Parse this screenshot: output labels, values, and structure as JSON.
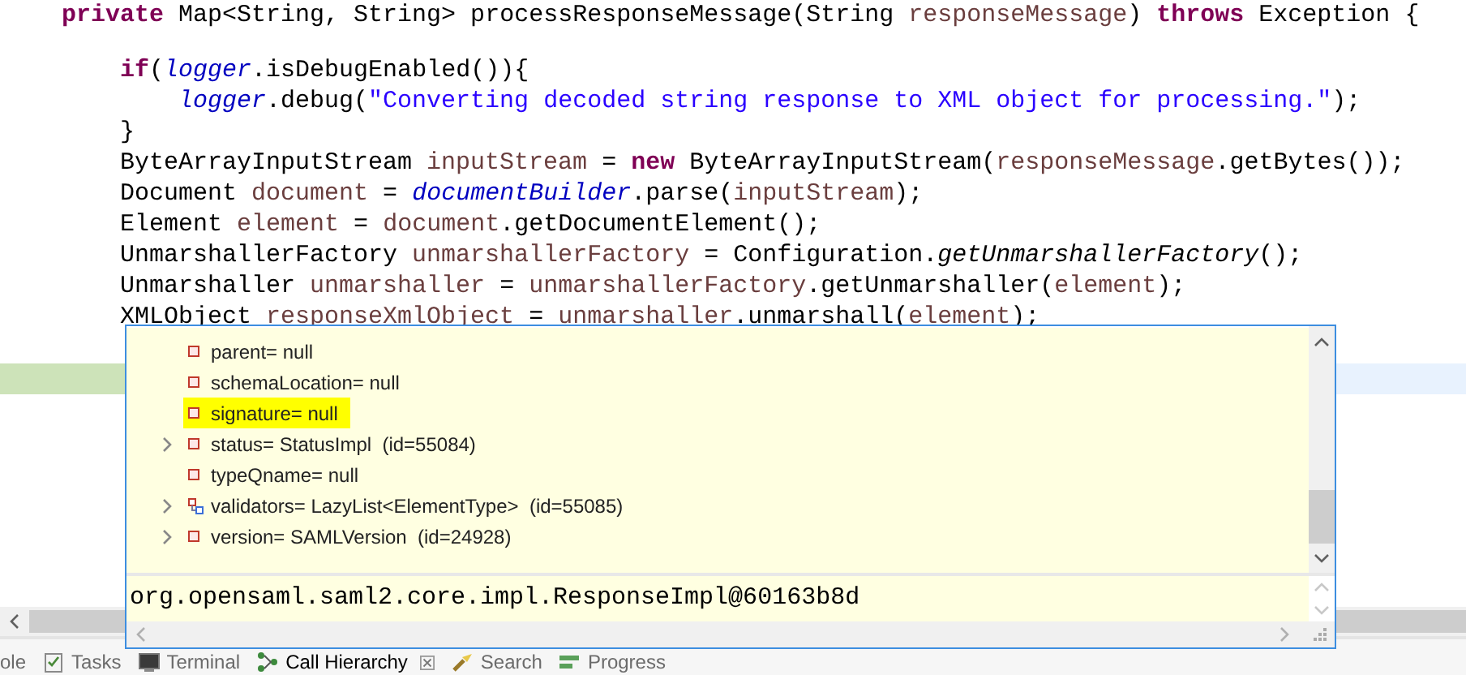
{
  "editor": {
    "lines": [
      {
        "kind": "code",
        "tokens": [
          {
            "kind": "keyword",
            "text": "    private"
          },
          {
            "kind": "plain",
            "text": " Map<String, String> processResponseMessage(String "
          },
          {
            "kind": "variable",
            "text": "responseMessage"
          },
          {
            "kind": "plain",
            "text": ") "
          },
          {
            "kind": "keyword",
            "text": "throws"
          },
          {
            "kind": "plain",
            "text": " Exception {"
          }
        ]
      },
      {
        "kind": "blank"
      },
      {
        "kind": "code",
        "tokens": [
          {
            "kind": "keyword",
            "text": "        if"
          },
          {
            "kind": "plain",
            "text": "("
          },
          {
            "kind": "field",
            "text": "logger"
          },
          {
            "kind": "plain",
            "text": ".isDebugEnabled()){"
          }
        ]
      },
      {
        "kind": "code",
        "tokens": [
          {
            "kind": "field",
            "text": "            logger"
          },
          {
            "kind": "plain",
            "text": ".debug("
          },
          {
            "kind": "string",
            "text": "\"Converting decoded string response to XML object for processing.\""
          },
          {
            "kind": "plain",
            "text": ");"
          }
        ]
      },
      {
        "kind": "code",
        "tokens": [
          {
            "kind": "plain",
            "text": "        }"
          }
        ]
      },
      {
        "kind": "code",
        "tokens": [
          {
            "kind": "plain",
            "text": "        ByteArrayInputStream "
          },
          {
            "kind": "variable",
            "text": "inputStream"
          },
          {
            "kind": "plain",
            "text": " = "
          },
          {
            "kind": "keyword",
            "text": "new"
          },
          {
            "kind": "plain",
            "text": " ByteArrayInputStream("
          },
          {
            "kind": "variable",
            "text": "responseMessage"
          },
          {
            "kind": "plain",
            "text": ".getBytes());"
          }
        ]
      },
      {
        "kind": "code",
        "tokens": [
          {
            "kind": "plain",
            "text": "        Document "
          },
          {
            "kind": "variable",
            "text": "document"
          },
          {
            "kind": "plain",
            "text": " = "
          },
          {
            "kind": "field",
            "text": "documentBuilder"
          },
          {
            "kind": "plain",
            "text": ".parse("
          },
          {
            "kind": "variable",
            "text": "inputStream"
          },
          {
            "kind": "plain",
            "text": ");"
          }
        ]
      },
      {
        "kind": "code",
        "tokens": [
          {
            "kind": "plain",
            "text": "        Element "
          },
          {
            "kind": "variable",
            "text": "element"
          },
          {
            "kind": "plain",
            "text": " = "
          },
          {
            "kind": "variable",
            "text": "document"
          },
          {
            "kind": "plain",
            "text": ".getDocumentElement();"
          }
        ]
      },
      {
        "kind": "code",
        "tokens": [
          {
            "kind": "plain",
            "text": "        UnmarshallerFactory "
          },
          {
            "kind": "variable",
            "text": "unmarshallerFactory"
          },
          {
            "kind": "plain",
            "text": " = Configuration."
          },
          {
            "kind": "static_method",
            "text": "getUnmarshallerFactory"
          },
          {
            "kind": "plain",
            "text": "();"
          }
        ]
      },
      {
        "kind": "code",
        "tokens": [
          {
            "kind": "plain",
            "text": "        Unmarshaller "
          },
          {
            "kind": "variable",
            "text": "unmarshaller"
          },
          {
            "kind": "plain",
            "text": " = "
          },
          {
            "kind": "variable",
            "text": "unmarshallerFactory"
          },
          {
            "kind": "plain",
            "text": ".getUnmarshaller("
          },
          {
            "kind": "variable",
            "text": "element"
          },
          {
            "kind": "plain",
            "text": ");"
          }
        ]
      },
      {
        "kind": "code",
        "tokens": [
          {
            "kind": "plain",
            "text": "        XMLObject "
          },
          {
            "kind": "variable",
            "text": "responseXmlObject"
          },
          {
            "kind": "plain",
            "text": " = "
          },
          {
            "kind": "variable",
            "text": "unmarshaller"
          },
          {
            "kind": "plain",
            "text": ".unmarshall("
          },
          {
            "kind": "variable",
            "text": "element"
          },
          {
            "kind": "plain",
            "text": ");"
          }
        ]
      },
      {
        "kind": "blank"
      },
      {
        "kind": "debug_current"
      }
    ]
  },
  "inspect_popup": {
    "tree": [
      {
        "label": "parent= null",
        "kind": "field",
        "expandable": false,
        "highlighted": false
      },
      {
        "label": "schemaLocation= null",
        "kind": "field",
        "expandable": false,
        "highlighted": false
      },
      {
        "label": "signature= null",
        "kind": "field",
        "expandable": false,
        "highlighted": true
      },
      {
        "label": "status= StatusImpl  (id=55084)",
        "kind": "field",
        "expandable": true,
        "highlighted": false
      },
      {
        "label": "typeQname= null",
        "kind": "field",
        "expandable": false,
        "highlighted": false
      },
      {
        "label": "validators= LazyList<ElementType>  (id=55085)",
        "kind": "collection",
        "expandable": true,
        "highlighted": false
      },
      {
        "label": "version= SAMLVersion  (id=24928)",
        "kind": "field",
        "expandable": true,
        "highlighted": false
      }
    ],
    "detail": "org.opensaml.saml2.core.impl.ResponseImpl@60163b8d"
  },
  "view_tabs": [
    {
      "label": "ole",
      "kind": "console",
      "selected": false
    },
    {
      "label": "Tasks",
      "kind": "tasks",
      "selected": false
    },
    {
      "label": "Terminal",
      "kind": "terminal",
      "selected": false
    },
    {
      "label": "Call Hierarchy",
      "kind": "call_hierarchy",
      "selected": true
    },
    {
      "label": "Search",
      "kind": "search",
      "selected": false
    },
    {
      "label": "Progress",
      "kind": "progress",
      "selected": false
    }
  ]
}
